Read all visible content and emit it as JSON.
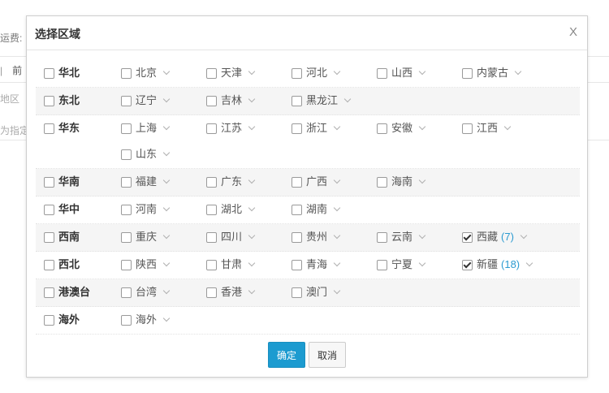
{
  "background": {
    "fragments": [
      "运费:",
      "前",
      "地区",
      "为指定"
    ]
  },
  "dialog": {
    "title": "选择区域",
    "close_label": "X",
    "confirm_label": "确定",
    "cancel_label": "取消",
    "regions": [
      {
        "name": "华北",
        "checked": false,
        "provinces": [
          {
            "name": "北京",
            "checked": false,
            "count": ""
          },
          {
            "name": "天津",
            "checked": false,
            "count": ""
          },
          {
            "name": "河北",
            "checked": false,
            "count": ""
          },
          {
            "name": "山西",
            "checked": false,
            "count": ""
          },
          {
            "name": "内蒙古",
            "checked": false,
            "count": ""
          }
        ]
      },
      {
        "name": "东北",
        "checked": false,
        "provinces": [
          {
            "name": "辽宁",
            "checked": false,
            "count": ""
          },
          {
            "name": "吉林",
            "checked": false,
            "count": ""
          },
          {
            "name": "黑龙江",
            "checked": false,
            "count": ""
          }
        ]
      },
      {
        "name": "华东",
        "checked": false,
        "provinces": [
          {
            "name": "上海",
            "checked": false,
            "count": ""
          },
          {
            "name": "江苏",
            "checked": false,
            "count": ""
          },
          {
            "name": "浙江",
            "checked": false,
            "count": ""
          },
          {
            "name": "安徽",
            "checked": false,
            "count": ""
          },
          {
            "name": "江西",
            "checked": false,
            "count": ""
          },
          {
            "name": "山东",
            "checked": false,
            "count": ""
          }
        ]
      },
      {
        "name": "华南",
        "checked": false,
        "provinces": [
          {
            "name": "福建",
            "checked": false,
            "count": ""
          },
          {
            "name": "广东",
            "checked": false,
            "count": ""
          },
          {
            "name": "广西",
            "checked": false,
            "count": ""
          },
          {
            "name": "海南",
            "checked": false,
            "count": ""
          }
        ]
      },
      {
        "name": "华中",
        "checked": false,
        "provinces": [
          {
            "name": "河南",
            "checked": false,
            "count": ""
          },
          {
            "name": "湖北",
            "checked": false,
            "count": ""
          },
          {
            "name": "湖南",
            "checked": false,
            "count": ""
          }
        ]
      },
      {
        "name": "西南",
        "checked": false,
        "provinces": [
          {
            "name": "重庆",
            "checked": false,
            "count": ""
          },
          {
            "name": "四川",
            "checked": false,
            "count": ""
          },
          {
            "name": "贵州",
            "checked": false,
            "count": ""
          },
          {
            "name": "云南",
            "checked": false,
            "count": ""
          },
          {
            "name": "西藏",
            "checked": true,
            "count": "(7)"
          }
        ]
      },
      {
        "name": "西北",
        "checked": false,
        "provinces": [
          {
            "name": "陕西",
            "checked": false,
            "count": ""
          },
          {
            "name": "甘肃",
            "checked": false,
            "count": ""
          },
          {
            "name": "青海",
            "checked": false,
            "count": ""
          },
          {
            "name": "宁夏",
            "checked": false,
            "count": ""
          },
          {
            "name": "新疆",
            "checked": true,
            "count": "(18)"
          }
        ]
      },
      {
        "name": "港澳台",
        "checked": false,
        "provinces": [
          {
            "name": "台湾",
            "checked": false,
            "count": ""
          },
          {
            "name": "香港",
            "checked": false,
            "count": ""
          },
          {
            "name": "澳门",
            "checked": false,
            "count": ""
          }
        ]
      },
      {
        "name": "海外",
        "checked": false,
        "provinces": [
          {
            "name": "海外",
            "checked": false,
            "count": ""
          }
        ]
      }
    ]
  }
}
